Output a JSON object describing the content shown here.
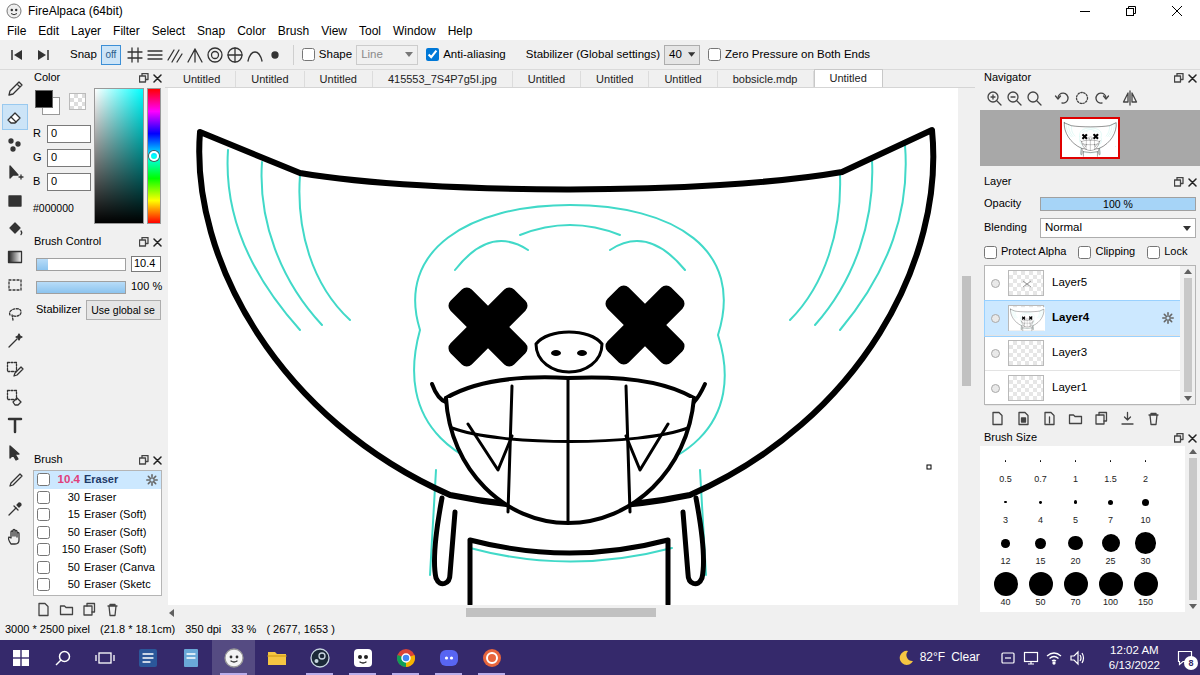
{
  "window": {
    "title": "FireAlpaca (64bit)"
  },
  "menu": [
    "File",
    "Edit",
    "Layer",
    "Filter",
    "Select",
    "Snap",
    "Color",
    "Brush",
    "View",
    "Tool",
    "Window",
    "Help"
  ],
  "toolbar": {
    "snap": {
      "label": "Snap",
      "off": "off",
      "off_selected": true
    },
    "shape": {
      "label": "Shape",
      "checked": false,
      "value": "Line",
      "disabled": true
    },
    "anti_aliasing": {
      "label": "Anti-aliasing",
      "checked": true
    },
    "stabilizer": {
      "label": "Stabilizer (Global settings)",
      "value": "40"
    },
    "zero_pressure": {
      "label": "Zero Pressure on Both Ends",
      "checked": false
    }
  },
  "tools": [
    {
      "selected": false
    },
    {
      "selected": true
    },
    {
      "selected": false
    },
    {
      "selected": false
    },
    {
      "selected": false
    },
    {
      "selected": false
    },
    {
      "selected": false
    },
    {
      "selected": false
    },
    {
      "selected": false
    },
    {
      "selected": false
    },
    {
      "selected": false
    },
    {
      "selected": false
    },
    {
      "selected": false
    },
    {
      "selected": false
    },
    {
      "selected": false
    },
    {
      "selected": false
    },
    {
      "selected": false
    }
  ],
  "color_panel": {
    "title": "Color",
    "fg_color": "#000000",
    "bg_color": "#ffffff",
    "channels": [
      {
        "label": "R",
        "value": "0"
      },
      {
        "label": "G",
        "value": "0"
      },
      {
        "label": "B",
        "value": "0"
      }
    ],
    "hex": "#000000",
    "hue_level": 0.5
  },
  "brush_control": {
    "title": "Brush Control",
    "size": "10.4",
    "size_level": 0.12,
    "opacity": "100 %",
    "opacity_level": 1,
    "stabilizer_label": "Stabilizer",
    "stabilizer_value": "Use global se"
  },
  "brush_panel": {
    "title": "Brush",
    "items": [
      {
        "size": "10.4",
        "name": "Eraser",
        "checked": false,
        "selected": true
      },
      {
        "size": "30",
        "name": "Eraser",
        "checked": false,
        "selected": false
      },
      {
        "size": "15",
        "name": "Eraser (Soft)",
        "checked": false,
        "selected": false
      },
      {
        "size": "50",
        "name": "Eraser (Soft)",
        "checked": false,
        "selected": false
      },
      {
        "size": "150",
        "name": "Eraser (Soft)",
        "checked": false,
        "selected": false
      },
      {
        "size": "50",
        "name": "Eraser (Canva",
        "checked": false,
        "selected": false
      },
      {
        "size": "50",
        "name": "Eraser (Sketc",
        "checked": false,
        "selected": false
      }
    ]
  },
  "doc_tabs": [
    {
      "label": "Untitled",
      "selected": false
    },
    {
      "label": "Untitled",
      "selected": false
    },
    {
      "label": "Untitled",
      "selected": false
    },
    {
      "label": "415553_7S4P7g5I.jpg",
      "selected": false
    },
    {
      "label": "Untitled",
      "selected": false
    },
    {
      "label": "Untitled",
      "selected": false
    },
    {
      "label": "Untitled",
      "selected": false
    },
    {
      "label": "bobsicle.mdp",
      "selected": false
    },
    {
      "label": "Untitled",
      "selected": true
    }
  ],
  "navigator": {
    "title": "Navigator"
  },
  "layer_panel": {
    "title": "Layer",
    "opacity_label": "Opacity",
    "opacity": "100 %",
    "opacity_level": 1,
    "blending_label": "Blending",
    "blending": "Normal",
    "options": [
      {
        "label": "Protect Alpha",
        "checked": false
      },
      {
        "label": "Clipping",
        "checked": false
      },
      {
        "label": "Lock",
        "checked": false
      }
    ],
    "layers": [
      {
        "name": "Layer5",
        "selected": false
      },
      {
        "name": "Layer4",
        "selected": true
      },
      {
        "name": "Layer3",
        "selected": false
      },
      {
        "name": "Layer1",
        "selected": false
      }
    ]
  },
  "brush_size": {
    "title": "Brush Size",
    "sizes": [
      "0.5",
      "0.7",
      "1",
      "1.5",
      "2",
      "3",
      "4",
      "5",
      "7",
      "10",
      "12",
      "15",
      "20",
      "25",
      "30",
      "40",
      "50",
      "70",
      "100",
      "150"
    ]
  },
  "status_bar": {
    "size": "3000 * 2500 pixel",
    "physical": "(21.8 * 18.1cm)",
    "dpi": "350 dpi",
    "zoom": "33 %",
    "cursor": "( 2677, 1653 )"
  },
  "taskbar": {
    "apps": [
      {
        "running": false,
        "active": false
      },
      {
        "running": false,
        "active": false
      },
      {
        "running": true,
        "active": true
      },
      {
        "running": false,
        "active": false
      },
      {
        "running": true,
        "active": false
      },
      {
        "running": true,
        "active": false
      },
      {
        "running": true,
        "active": false
      },
      {
        "running": true,
        "active": false
      },
      {
        "running": true,
        "active": false
      }
    ],
    "weather": "82°F",
    "condition": "Clear",
    "time": "12:02 AM",
    "date": "6/13/2022",
    "notifications": "8"
  }
}
